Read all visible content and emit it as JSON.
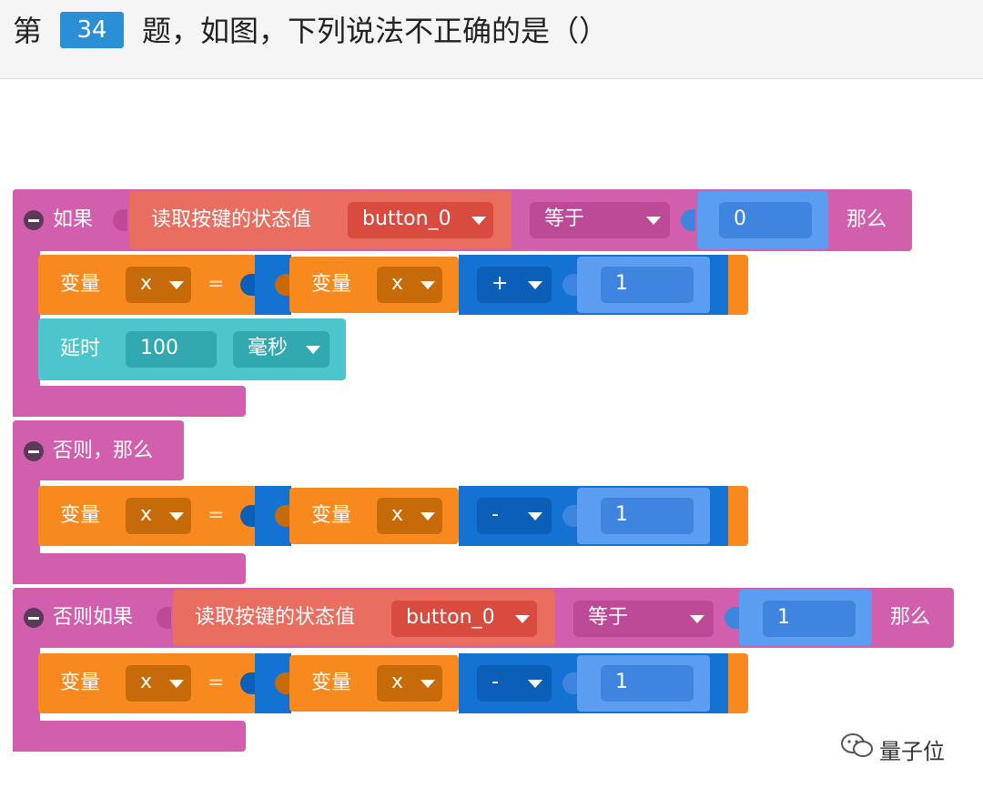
{
  "question": {
    "prefix": "第",
    "number": "34",
    "text": "题，如图，下列说法不正确的是（）"
  },
  "program": {
    "if_block": {
      "keyword": "如果",
      "read_label": "读取按键的状态值",
      "button": "button_0",
      "operator": "等于",
      "value": "0",
      "then": "那么",
      "assign": {
        "var_label": "变量",
        "var": "x",
        "eq": "=",
        "rhs_label": "变量",
        "rhs_var": "x",
        "op": "+",
        "num": "1"
      },
      "delay": {
        "label": "延时",
        "value": "100",
        "unit": "毫秒"
      }
    },
    "else_block": {
      "keyword": "否则，那么",
      "assign": {
        "var_label": "变量",
        "var": "x",
        "eq": "=",
        "rhs_label": "变量",
        "rhs_var": "x",
        "op": "-",
        "num": "1"
      }
    },
    "elseif_block": {
      "keyword": "否则如果",
      "read_label": "读取按键的状态值",
      "button": "button_0",
      "operator": "等于",
      "value": "1",
      "then": "那么",
      "assign": {
        "var_label": "变量",
        "var": "x",
        "eq": "=",
        "rhs_label": "变量",
        "rhs_var": "x",
        "op": "-",
        "num": "1"
      }
    }
  },
  "watermark": {
    "name": "量子位",
    "icon": "wechat-icon"
  },
  "colors": {
    "control": "#d25fae",
    "sensor": "#ea6e60",
    "variable": "#f8891f",
    "math": "#1372d2",
    "number": "#5b9df0",
    "time": "#4dc5cc"
  }
}
